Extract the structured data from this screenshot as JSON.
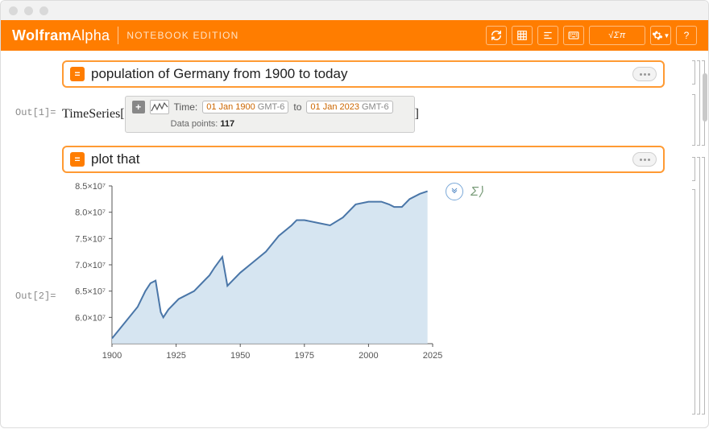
{
  "header": {
    "brand_bold": "Wolfram",
    "brand_light": "Alpha",
    "edition": "NOTEBOOK EDITION",
    "btn_sqrt": "√Σπ"
  },
  "out1_label": "Out[1]=",
  "out2_label": "Out[2]=",
  "input1": {
    "text": "population of Germany from 1900 to today"
  },
  "input2": {
    "text": "plot that"
  },
  "timeseries": {
    "prefix": "TimeSeries[",
    "suffix": "]",
    "time_label": "Time:",
    "start_date": "01 Jan 1900",
    "start_tz": "GMT-6",
    "to": "to",
    "end_date": "01 Jan 2023",
    "end_tz": "GMT-6",
    "points_label": "Data points:",
    "points_value": "117"
  },
  "chart_data": {
    "type": "area",
    "title": "",
    "xlabel": "",
    "ylabel": "",
    "xlim": [
      1900,
      2025
    ],
    "ylim": [
      55000000,
      85000000
    ],
    "x_ticks": [
      1900,
      1925,
      1950,
      1975,
      2000,
      2025
    ],
    "y_ticks": [
      60000000,
      65000000,
      70000000,
      75000000,
      80000000,
      85000000
    ],
    "y_tick_labels": [
      "6.0×10⁷",
      "6.5×10⁷",
      "7.0×10⁷",
      "7.5×10⁷",
      "8.0×10⁷",
      "8.5×10⁷"
    ],
    "series": [
      {
        "name": "population of Germany",
        "x": [
          1900,
          1905,
          1910,
          1913,
          1915,
          1917,
          1919,
          1920,
          1922,
          1924,
          1926,
          1928,
          1932,
          1935,
          1938,
          1940,
          1943,
          1945,
          1947,
          1950,
          1955,
          1960,
          1965,
          1970,
          1972,
          1975,
          1980,
          1985,
          1990,
          1995,
          2000,
          2005,
          2008,
          2010,
          2013,
          2016,
          2020,
          2023
        ],
        "values": [
          56000000.0,
          59000000.0,
          62000000.0,
          65000000.0,
          66500000.0,
          67000000.0,
          61000000.0,
          60000000.0,
          61500000.0,
          62500000.0,
          63500000.0,
          64000000.0,
          65000000.0,
          66500000.0,
          68000000.0,
          69500000.0,
          71500000.0,
          66000000.0,
          67000000.0,
          68500000.0,
          70500000.0,
          72500000.0,
          75500000.0,
          77500000.0,
          78500000.0,
          78500000.0,
          78000000.0,
          77500000.0,
          79000000.0,
          81500000.0,
          82000000.0,
          82000000.0,
          81500000.0,
          81000000.0,
          81000000.0,
          82500000.0,
          83500000.0,
          84000000.0
        ]
      }
    ]
  }
}
